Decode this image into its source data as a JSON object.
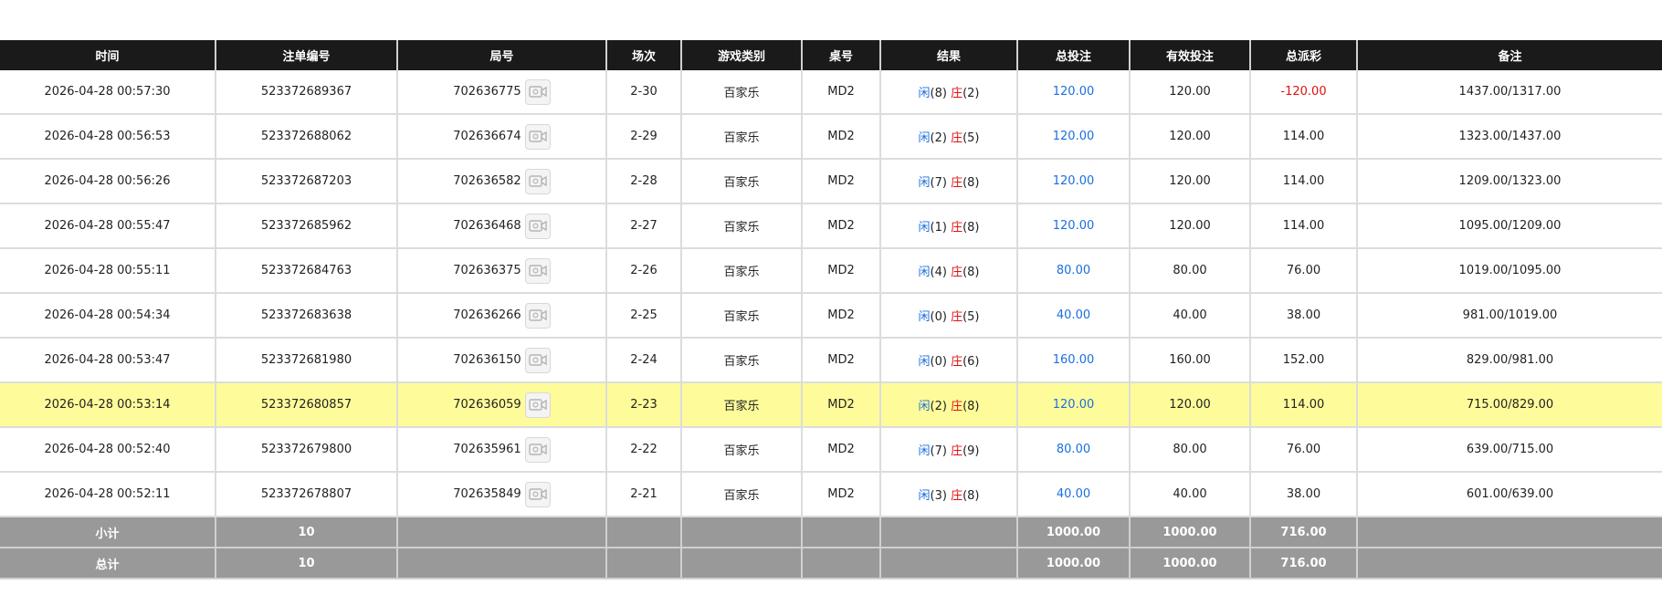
{
  "headers": [
    "时间",
    "注单编号",
    "局号",
    "场次",
    "游戏类别",
    "桌号",
    "结果",
    "总投注",
    "有效投注",
    "总派彩",
    "备注"
  ],
  "result_labels": {
    "player": "闲",
    "banker": "庄"
  },
  "icon": "video-replay-icon",
  "colors": {
    "header_bg": "#1a1a1a",
    "footer_bg": "#999999",
    "highlight": "#fefc9a",
    "player": "#1a6fe0",
    "banker": "#e01010"
  },
  "rows": [
    {
      "time": "2026-04-28 00:57:30",
      "bet_id": "523372689367",
      "round": "702636775",
      "shoe": "2-30",
      "game": "百家乐",
      "table": "MD2",
      "player_score": "(8)",
      "banker_score": "(2)",
      "total_bet": "120.00",
      "valid_bet": "120.00",
      "payout": "-120.00",
      "note": "1437.00/1317.00"
    },
    {
      "time": "2026-04-28 00:56:53",
      "bet_id": "523372688062",
      "round": "702636674",
      "shoe": "2-29",
      "game": "百家乐",
      "table": "MD2",
      "player_score": "(2)",
      "banker_score": "(5)",
      "total_bet": "120.00",
      "valid_bet": "120.00",
      "payout": "114.00",
      "note": "1323.00/1437.00"
    },
    {
      "time": "2026-04-28 00:56:26",
      "bet_id": "523372687203",
      "round": "702636582",
      "shoe": "2-28",
      "game": "百家乐",
      "table": "MD2",
      "player_score": "(7)",
      "banker_score": "(8)",
      "total_bet": "120.00",
      "valid_bet": "120.00",
      "payout": "114.00",
      "note": "1209.00/1323.00"
    },
    {
      "time": "2026-04-28 00:55:47",
      "bet_id": "523372685962",
      "round": "702636468",
      "shoe": "2-27",
      "game": "百家乐",
      "table": "MD2",
      "player_score": "(1)",
      "banker_score": "(8)",
      "total_bet": "120.00",
      "valid_bet": "120.00",
      "payout": "114.00",
      "note": "1095.00/1209.00"
    },
    {
      "time": "2026-04-28 00:55:11",
      "bet_id": "523372684763",
      "round": "702636375",
      "shoe": "2-26",
      "game": "百家乐",
      "table": "MD2",
      "player_score": "(4)",
      "banker_score": "(8)",
      "total_bet": "80.00",
      "valid_bet": "80.00",
      "payout": "76.00",
      "note": "1019.00/1095.00"
    },
    {
      "time": "2026-04-28 00:54:34",
      "bet_id": "523372683638",
      "round": "702636266",
      "shoe": "2-25",
      "game": "百家乐",
      "table": "MD2",
      "player_score": "(0)",
      "banker_score": "(5)",
      "total_bet": "40.00",
      "valid_bet": "40.00",
      "payout": "38.00",
      "note": "981.00/1019.00"
    },
    {
      "time": "2026-04-28 00:53:47",
      "bet_id": "523372681980",
      "round": "702636150",
      "shoe": "2-24",
      "game": "百家乐",
      "table": "MD2",
      "player_score": "(0)",
      "banker_score": "(6)",
      "total_bet": "160.00",
      "valid_bet": "160.00",
      "payout": "152.00",
      "note": "829.00/981.00"
    },
    {
      "time": "2026-04-28 00:53:14",
      "bet_id": "523372680857",
      "round": "702636059",
      "shoe": "2-23",
      "game": "百家乐",
      "table": "MD2",
      "player_score": "(2)",
      "banker_score": "(8)",
      "total_bet": "120.00",
      "valid_bet": "120.00",
      "payout": "114.00",
      "note": "715.00/829.00",
      "highlighted": true
    },
    {
      "time": "2026-04-28 00:52:40",
      "bet_id": "523372679800",
      "round": "702635961",
      "shoe": "2-22",
      "game": "百家乐",
      "table": "MD2",
      "player_score": "(7)",
      "banker_score": "(9)",
      "total_bet": "80.00",
      "valid_bet": "80.00",
      "payout": "76.00",
      "note": "639.00/715.00"
    },
    {
      "time": "2026-04-28 00:52:11",
      "bet_id": "523372678807",
      "round": "702635849",
      "shoe": "2-21",
      "game": "百家乐",
      "table": "MD2",
      "player_score": "(3)",
      "banker_score": "(8)",
      "total_bet": "40.00",
      "valid_bet": "40.00",
      "payout": "38.00",
      "note": "601.00/639.00"
    }
  ],
  "subtotal": {
    "label": "小计",
    "count": "10",
    "total_bet": "1000.00",
    "valid_bet": "1000.00",
    "payout": "716.00"
  },
  "grand_total": {
    "label": "总计",
    "count": "10",
    "total_bet": "1000.00",
    "valid_bet": "1000.00",
    "payout": "716.00"
  }
}
